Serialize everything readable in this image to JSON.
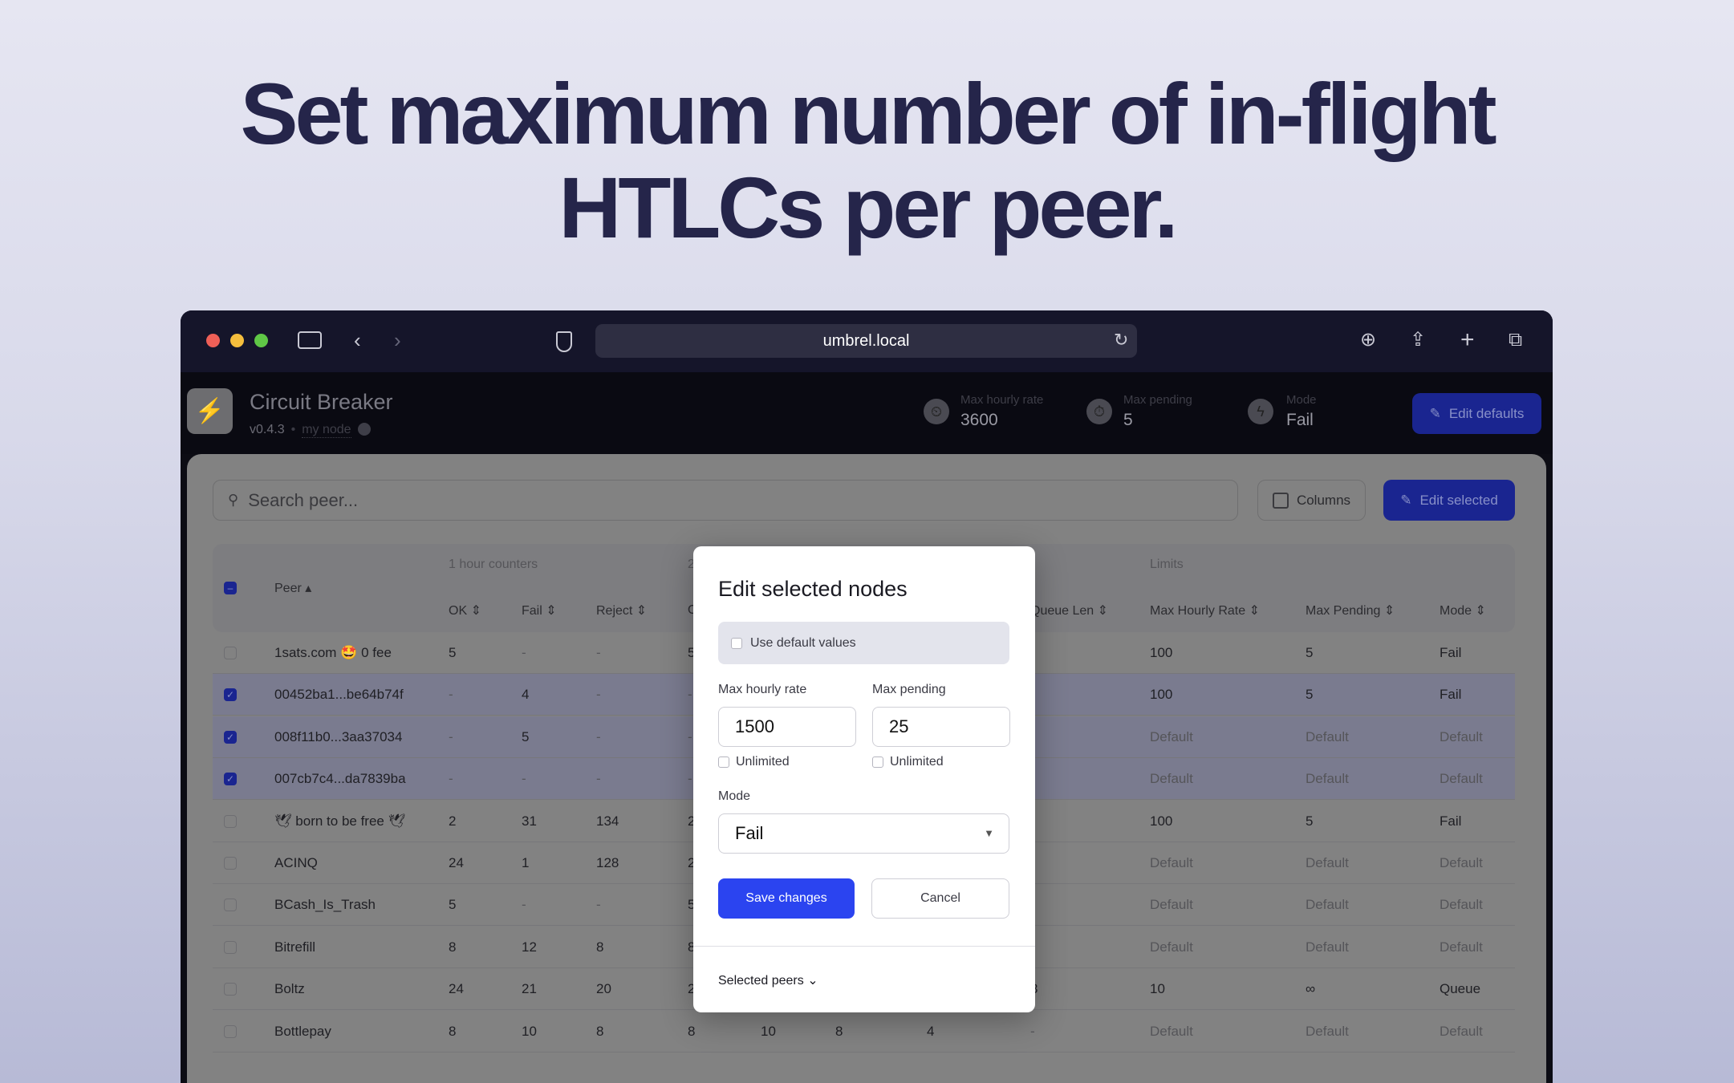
{
  "headline": {
    "line1": "Set maximum number of in-flight",
    "line2": "HTLCs per peer."
  },
  "browser": {
    "url": "umbrel.local",
    "icons": [
      "sidebar-icon",
      "back-icon",
      "forward-icon",
      "shield-icon",
      "reload-icon",
      "download-icon",
      "share-icon",
      "plus-icon",
      "tabs-icon"
    ]
  },
  "app": {
    "name": "Circuit Breaker",
    "version": "v0.4.3",
    "separator": "•",
    "node_link": "my node",
    "stats": [
      {
        "label": "Max hourly rate",
        "value": "3600"
      },
      {
        "label": "Max pending",
        "value": "5"
      },
      {
        "label": "Mode",
        "value": "Fail"
      }
    ],
    "edit_defaults": "Edit defaults"
  },
  "toolbar": {
    "search_placeholder": "Search peer...",
    "columns": "Columns",
    "edit_selected": "Edit selected"
  },
  "table": {
    "groups": {
      "hour": "1 hour counters",
      "day": "2",
      "limits": "Limits"
    },
    "columns": {
      "peer": "Peer",
      "ok": "OK",
      "fail": "Fail",
      "reject": "Reject",
      "ok24": "O",
      "queue": "Queue Len",
      "max_rate": "Max Hourly Rate",
      "max_pending": "Max Pending",
      "mode": "Mode"
    },
    "rows": [
      {
        "selected": false,
        "peer": "1sats.com 🤩 0 fee",
        "ok": "5",
        "fail": "-",
        "reject": "-",
        "c4": "5",
        "c5": "",
        "c6": "",
        "c7": "",
        "queue": "",
        "rate": "100",
        "pending": "5",
        "mode": "Fail"
      },
      {
        "selected": true,
        "peer": "00452ba1...be64b74f",
        "ok": "-",
        "fail": "4",
        "reject": "-",
        "c4": "-",
        "c5": "",
        "c6": "",
        "c7": "",
        "queue": "",
        "rate": "100",
        "pending": "5",
        "mode": "Fail"
      },
      {
        "selected": true,
        "peer": "008f11b0...3aa37034",
        "ok": "-",
        "fail": "5",
        "reject": "-",
        "c4": "-",
        "c5": "",
        "c6": "",
        "c7": "",
        "queue": "",
        "rate": "Default",
        "pending": "Default",
        "mode": "Default"
      },
      {
        "selected": true,
        "peer": "007cb7c4...da7839ba",
        "ok": "-",
        "fail": "-",
        "reject": "-",
        "c4": "-",
        "c5": "",
        "c6": "",
        "c7": "",
        "queue": "",
        "rate": "Default",
        "pending": "Default",
        "mode": "Default"
      },
      {
        "selected": false,
        "peer": "🕊 born to be free 🕊",
        "ok": "2",
        "fail": "31",
        "reject": "134",
        "c4": "2",
        "c5": "",
        "c6": "",
        "c7": "",
        "queue": "",
        "rate": "100",
        "pending": "5",
        "mode": "Fail"
      },
      {
        "selected": false,
        "peer": "ACINQ",
        "ok": "24",
        "fail": "1",
        "reject": "128",
        "c4": "2",
        "c5": "",
        "c6": "",
        "c7": "",
        "queue": "",
        "rate": "Default",
        "pending": "Default",
        "mode": "Default"
      },
      {
        "selected": false,
        "peer": "BCash_Is_Trash",
        "ok": "5",
        "fail": "-",
        "reject": "-",
        "c4": "5",
        "c5": "",
        "c6": "",
        "c7": "",
        "queue": "",
        "rate": "Default",
        "pending": "Default",
        "mode": "Default"
      },
      {
        "selected": false,
        "peer": "Bitrefill",
        "ok": "8",
        "fail": "12",
        "reject": "8",
        "c4": "8",
        "c5": "",
        "c6": "",
        "c7": "",
        "queue": "",
        "rate": "Default",
        "pending": "Default",
        "mode": "Default"
      },
      {
        "selected": false,
        "peer": "Boltz",
        "ok": "24",
        "fail": "21",
        "reject": "20",
        "c4": "2",
        "c5": "",
        "c6": "",
        "c7": "",
        "queue": "8",
        "rate": "10",
        "pending": "∞",
        "mode": "Queue"
      },
      {
        "selected": false,
        "peer": "Bottlepay",
        "ok": "8",
        "fail": "10",
        "reject": "8",
        "c4": "8",
        "c5": "10",
        "c6": "8",
        "c7": "4",
        "queue": "-",
        "rate": "Default",
        "pending": "Default",
        "mode": "Default"
      }
    ]
  },
  "modal": {
    "title": "Edit selected nodes",
    "use_default": "Use default values",
    "max_rate_label": "Max hourly rate",
    "max_rate_value": "1500",
    "max_pending_label": "Max pending",
    "max_pending_value": "25",
    "unlimited": "Unlimited",
    "mode_label": "Mode",
    "mode_value": "Fail",
    "save": "Save changes",
    "cancel": "Cancel",
    "selected_peers": "Selected peers"
  },
  "colors": {
    "accent": "#2b44f0",
    "accent_dimmed": "#1a2590",
    "toolbar": "#15152a",
    "headline": "#25254a"
  }
}
